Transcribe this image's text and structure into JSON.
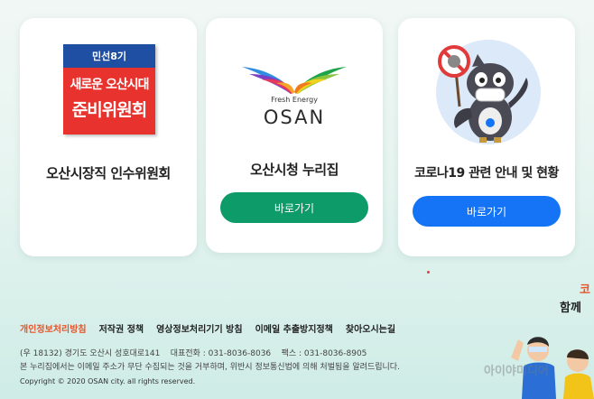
{
  "cards": [
    {
      "title": "오산시장직 인수위원회",
      "logo": {
        "top_text": "민선8기",
        "line1": "새로운 오산시대",
        "line2": "준비위원회"
      }
    },
    {
      "title": "오산시청 누리집",
      "logo": {
        "tagline": "Fresh Energy",
        "name": "OSAN"
      },
      "button": "바로가기",
      "button_color": "#0e9b6a"
    },
    {
      "title": "코로나19 관련 안내 및 현황",
      "button": "바로가기",
      "button_color": "#1574f5",
      "mascot_icon": "bird-mascot-with-mask-icon"
    }
  ],
  "footer": {
    "links": [
      "개인정보처리방침",
      "저작권 정책",
      "영상정보처리기기 방침",
      "이메일 추출방지정책",
      "찾아오시는길"
    ],
    "address": "(우 18132) 경기도 오산시 성호대로141    대표전화 : 031-8036-8036    팩스 : 031-8036-8905",
    "notice": "본 누리집에서는 이메일 주소가 무단 수집되는 것을 거부하며, 위반시 정보통신법에 의해 처벌됨을 알려드립니다.",
    "copyright": "Copyright © 2020 OSAN city. all rights reserved."
  },
  "side_fragment": {
    "line1": "코",
    "line2": "함께"
  },
  "watermark": "아이야미디어"
}
